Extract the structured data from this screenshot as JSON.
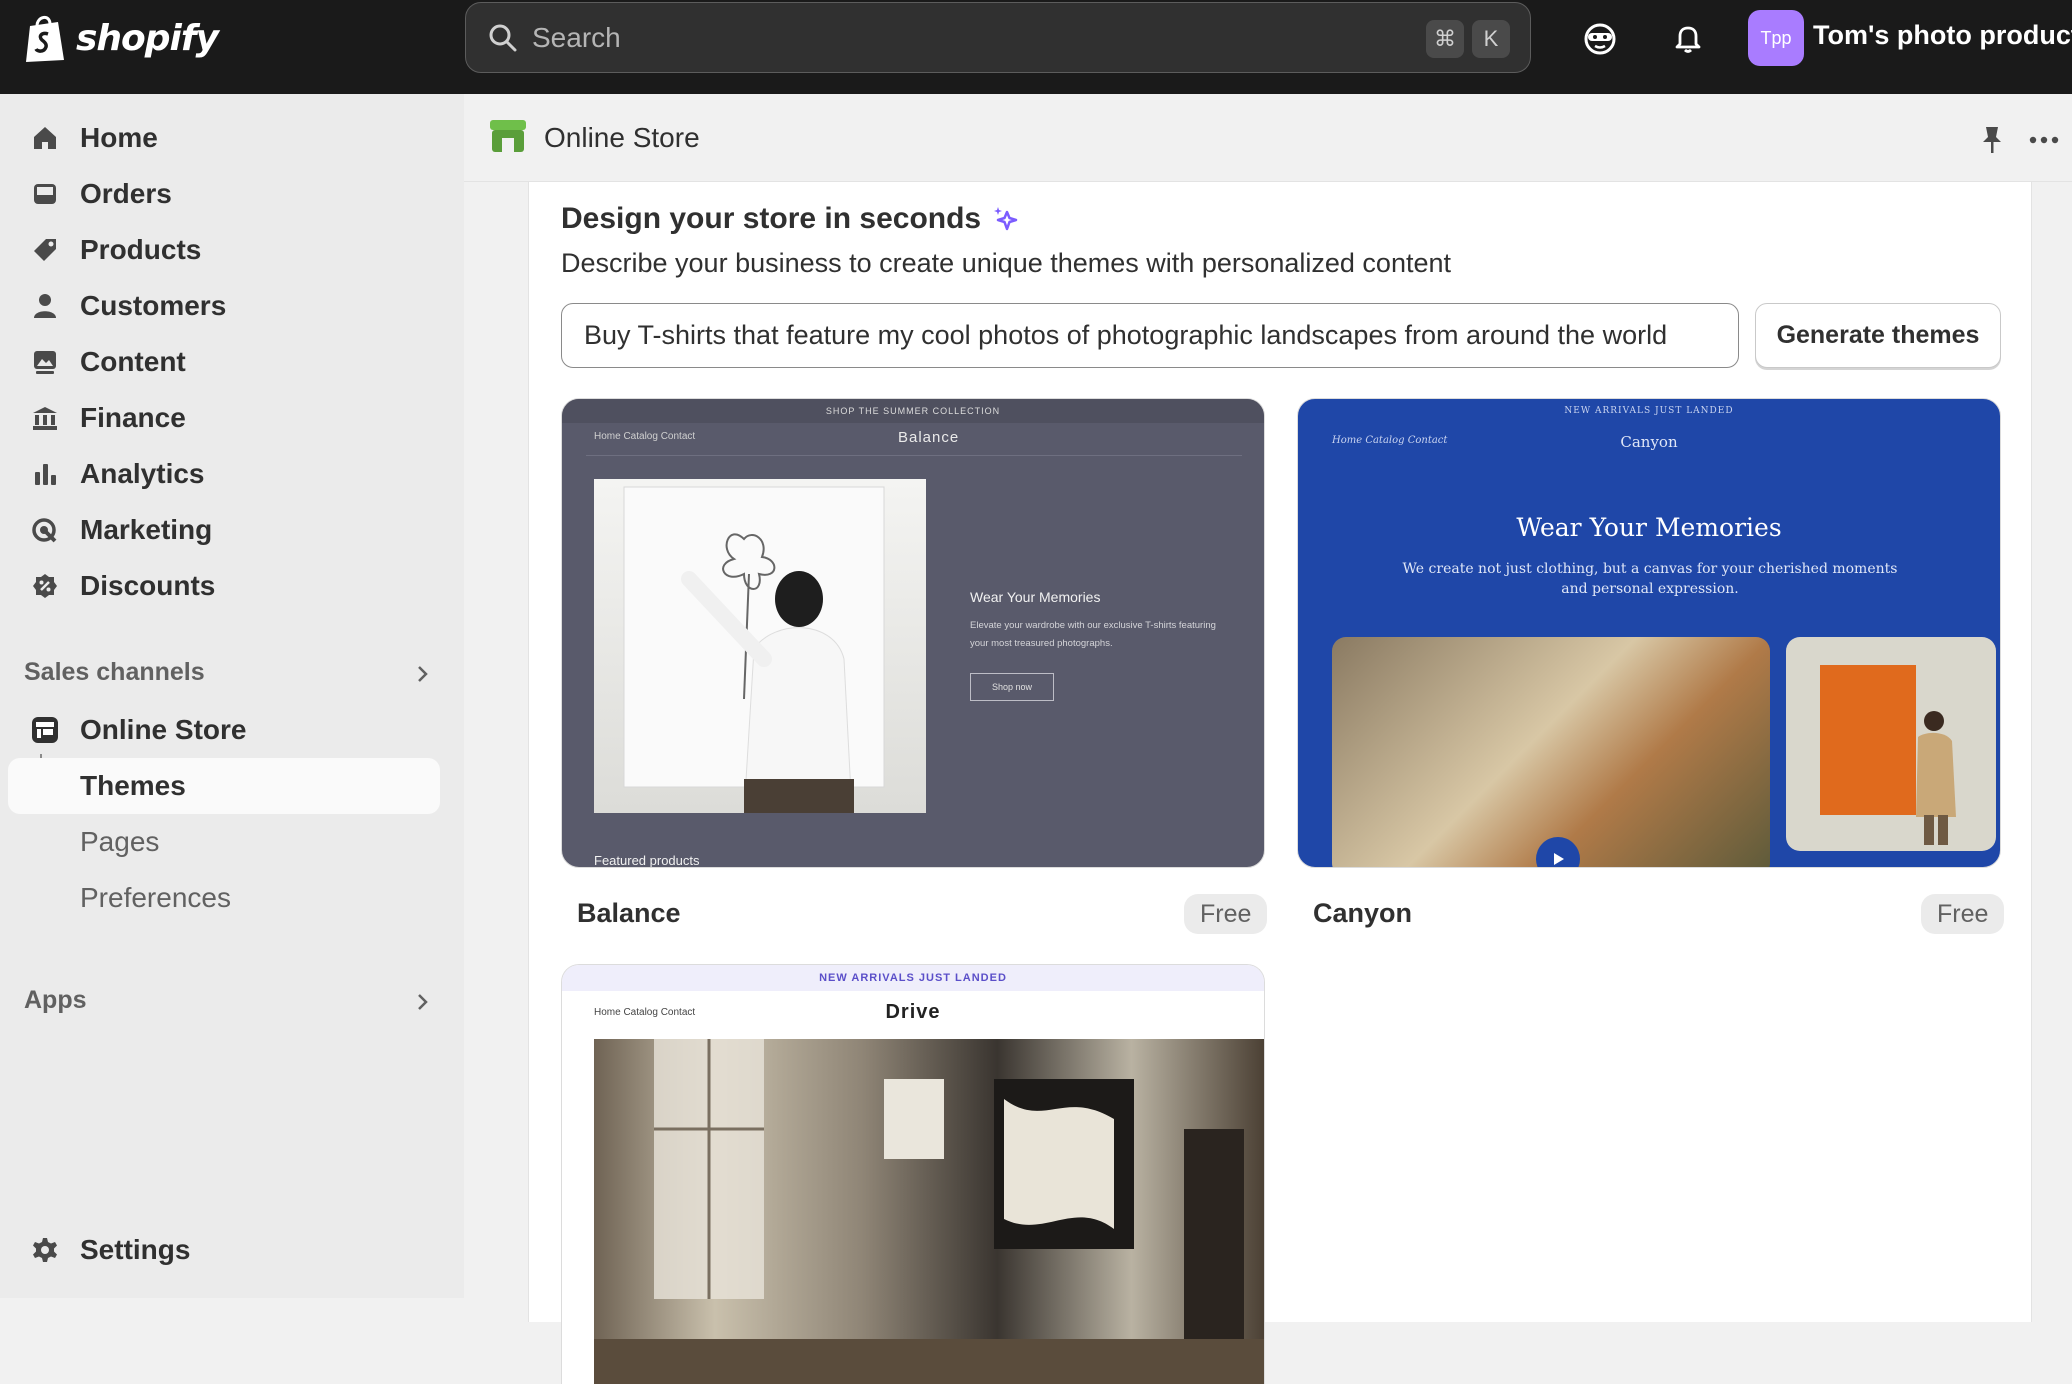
{
  "topbar": {
    "logo_text": "shopify",
    "search_placeholder": "Search",
    "kbd_cmd": "⌘",
    "kbd_key": "K",
    "avatar_initials": "Tpp",
    "store_name": "Tom's photo products"
  },
  "sidebar": {
    "items": [
      {
        "label": "Home",
        "icon": "home-icon"
      },
      {
        "label": "Orders",
        "icon": "inbox-icon"
      },
      {
        "label": "Products",
        "icon": "tag-icon"
      },
      {
        "label": "Customers",
        "icon": "person-icon"
      },
      {
        "label": "Content",
        "icon": "image-icon"
      },
      {
        "label": "Finance",
        "icon": "bank-icon"
      },
      {
        "label": "Analytics",
        "icon": "bar-chart-icon"
      },
      {
        "label": "Marketing",
        "icon": "target-icon"
      },
      {
        "label": "Discounts",
        "icon": "discount-icon"
      }
    ],
    "sales_channels_label": "Sales channels",
    "online_store_label": "Online Store",
    "sub_items": [
      "Themes",
      "Pages",
      "Preferences"
    ],
    "apps_label": "Apps",
    "settings_label": "Settings"
  },
  "header": {
    "title": "Online Store"
  },
  "design": {
    "title": "Design your store in seconds",
    "description": "Describe your business to create unique themes with personalized content",
    "prompt_value": "Buy T-shirts that feature my cool photos of photographic landscapes from around the world",
    "generate_label": "Generate themes"
  },
  "themes": [
    {
      "name": "Balance",
      "price": "Free",
      "preview": {
        "announcement": "SHOP THE SUMMER COLLECTION",
        "nav": "Home   Catalog   Contact",
        "brand": "Balance",
        "heading": "Wear Your Memories",
        "body": "Elevate your wardrobe with our exclusive T-shirts featuring your most treasured photographs.",
        "button": "Shop now",
        "section": "Featured products"
      }
    },
    {
      "name": "Canyon",
      "price": "Free",
      "preview": {
        "announcement": "NEW ARRIVALS JUST LANDED",
        "nav": "Home   Catalog   Contact",
        "brand": "Canyon",
        "heading": "Wear Your Memories",
        "body": "We create not just clothing, but a canvas for your cherished moments and personal expression."
      }
    },
    {
      "name": "Drive",
      "preview": {
        "announcement": "NEW ARRIVALS JUST LANDED",
        "nav": "Home   Catalog   Contact",
        "brand": "Drive"
      }
    }
  ],
  "colors": {
    "topbar": "#1a1a1a",
    "avatar": "#a97cff",
    "sparkle": "#7b5cff",
    "canyon": "#1f47a8",
    "balance": "#595a6b"
  }
}
